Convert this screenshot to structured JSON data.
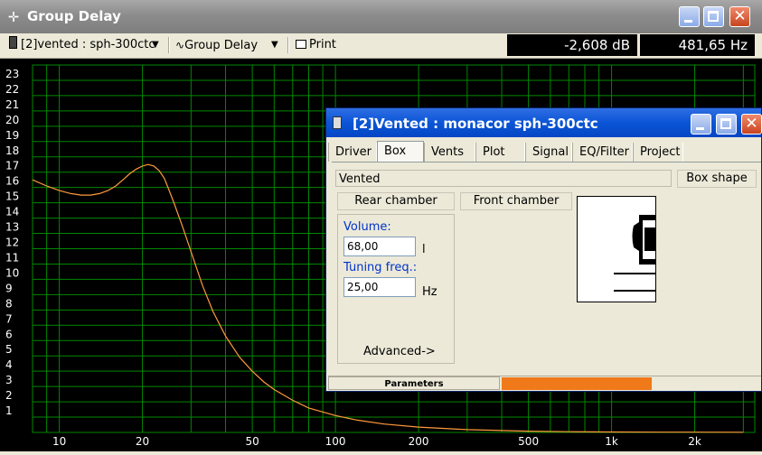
{
  "window": {
    "title": "Group Delay",
    "title_icon": "crosshair-icon"
  },
  "toolbar": {
    "project_select": "[2]vented : sph-300ctc",
    "view_select": "Group Delay",
    "print_label": "Print",
    "readout_db": "-2,608 dB",
    "readout_hz": "481,65 Hz"
  },
  "chart_data": {
    "type": "line",
    "xscale": "log",
    "xlim": [
      8,
      3300
    ],
    "ylim": [
      0,
      24
    ],
    "x_tick_labels": [
      "10",
      "20",
      "50",
      "100",
      "200",
      "500",
      "1k",
      "2k"
    ],
    "y_tick_labels": [
      "23",
      "22",
      "21",
      "20",
      "19",
      "18",
      "17",
      "16",
      "15",
      "14",
      "13",
      "12",
      "11",
      "10",
      "9",
      "8",
      "7",
      "6",
      "5",
      "4",
      "3",
      "2",
      "1"
    ],
    "grid": true,
    "colors": {
      "background": "#000000",
      "grid": "#008800",
      "curve": "#ff9a3c",
      "labels": "#ffffff"
    },
    "series": [
      {
        "x": [
          8,
          9,
          10,
          11,
          12,
          13,
          14,
          15,
          16,
          17,
          18,
          19,
          20,
          21,
          22,
          23,
          24,
          25,
          26,
          28,
          30,
          33,
          36,
          40,
          45,
          50,
          55,
          60,
          70,
          80,
          100,
          120,
          150,
          200,
          300,
          500,
          700,
          1000,
          1500,
          2000,
          3000
        ],
        "y": [
          16.5,
          16.1,
          15.8,
          15.6,
          15.5,
          15.5,
          15.6,
          15.8,
          16.1,
          16.5,
          16.9,
          17.2,
          17.4,
          17.5,
          17.4,
          17.1,
          16.6,
          15.8,
          15.0,
          13.4,
          11.8,
          9.6,
          7.9,
          6.3,
          4.9,
          4.0,
          3.3,
          2.8,
          2.1,
          1.6,
          1.1,
          0.8,
          0.55,
          0.35,
          0.18,
          0.08,
          0.05,
          0.03,
          0.02,
          0.015,
          0.01
        ]
      }
    ]
  },
  "dialog": {
    "title": "[2]Vented : monacor sph-300ctc",
    "tabs": [
      "Driver",
      "Box",
      "Vents",
      "Plot",
      "Signal",
      "EQ/Filter",
      "Project"
    ],
    "active_tab": "Box",
    "box_type_value": "Vented",
    "box_shape_button": "Box shape",
    "rear_chamber_button": "Rear chamber",
    "front_chamber_button": "Front chamber",
    "volume_label": "Volume:",
    "volume_value": "68,00",
    "volume_unit": "l",
    "tuning_label": "Tuning freq.:",
    "tuning_value": "25,00",
    "tuning_unit": "Hz",
    "advanced_label": "Advanced->",
    "status_label": "Parameters",
    "status_progress": 0.58,
    "status_color": "#f07a1a"
  }
}
